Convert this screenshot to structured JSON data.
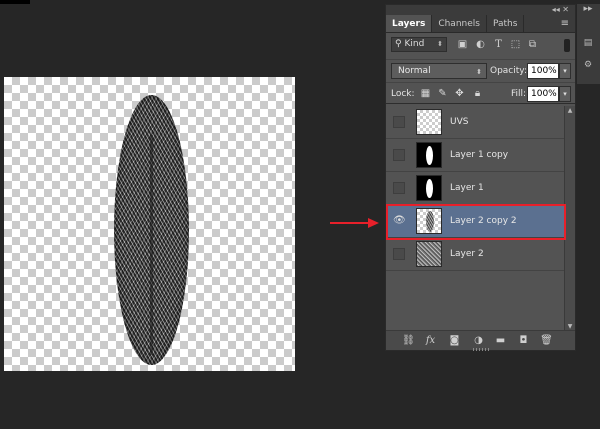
{
  "panel": {
    "tabs": [
      "Layers",
      "Channels",
      "Paths"
    ],
    "filter": {
      "label": "Kind"
    },
    "blend_mode": "Normal",
    "opacity_label": "Opacity:",
    "opacity_value": "100%",
    "lock_label": "Lock:",
    "fill_label": "Fill:",
    "fill_value": "100%"
  },
  "layers": [
    {
      "name": "UVS",
      "visible": false,
      "thumb": "transparent"
    },
    {
      "name": "Layer 1 copy",
      "visible": false,
      "thumb": "mask"
    },
    {
      "name": "Layer 1",
      "visible": false,
      "thumb": "mask"
    },
    {
      "name": "Layer 2 copy 2",
      "visible": true,
      "selected": true,
      "thumb": "feather"
    },
    {
      "name": "Layer 2",
      "visible": false,
      "thumb": "noise"
    }
  ],
  "icons": {
    "filter": [
      "image-filter-icon",
      "adjustment-filter-icon",
      "type-filter-icon",
      "shape-filter-icon",
      "smart-object-filter-icon"
    ],
    "lock": [
      "lock-transparent-icon",
      "lock-image-icon",
      "lock-position-icon",
      "lock-all-icon"
    ],
    "bottom": [
      "link-layers-icon",
      "fx-icon",
      "add-mask-icon",
      "adjustment-layer-icon",
      "new-group-icon",
      "new-layer-icon",
      "delete-layer-icon"
    ]
  },
  "colors": {
    "selection": "#5b7090",
    "highlight": "#e8202a",
    "panel": "#535353"
  }
}
